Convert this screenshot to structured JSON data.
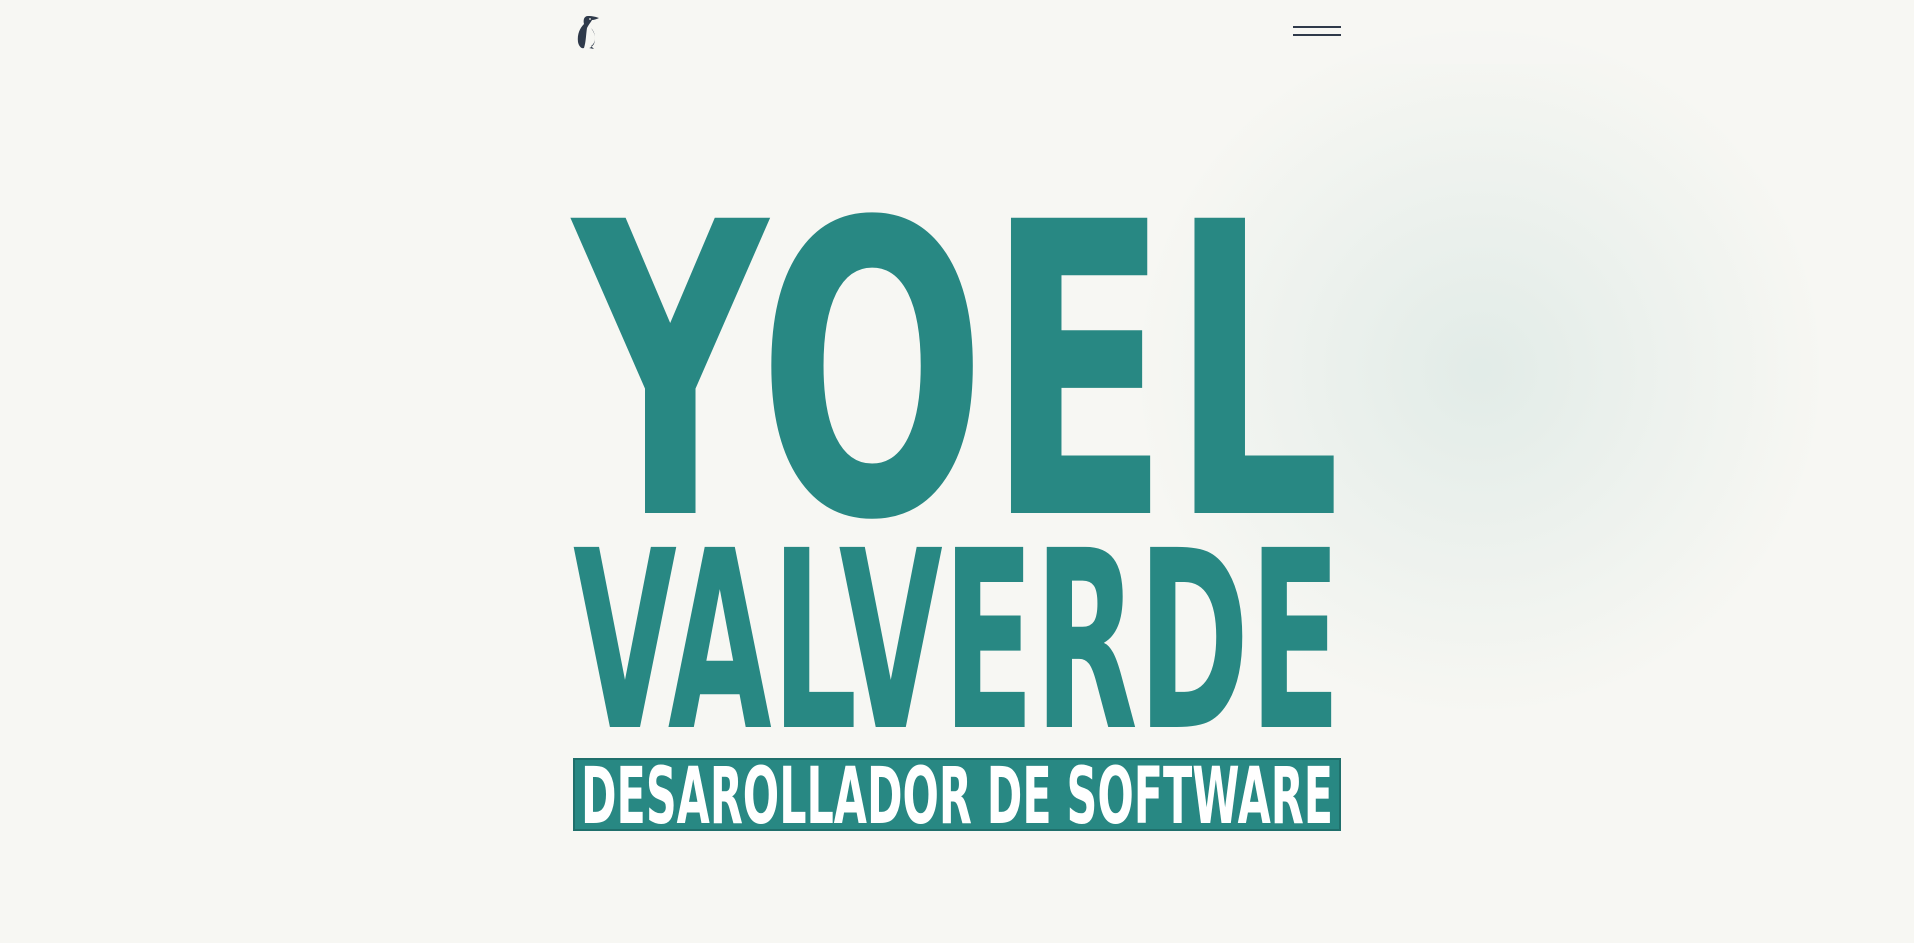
{
  "header": {
    "logo_icon": "penguin-icon",
    "menu_icon": "hamburger-menu-icon"
  },
  "hero": {
    "first_name": "YOEL",
    "last_name": "VALVERDE",
    "tagline": "DESAROLLADOR DE SOFTWARE"
  },
  "colors": {
    "accent": "#288883",
    "background": "#f7f7f3",
    "icon": "#2f3a4a",
    "tagline_text": "#ffffff"
  }
}
